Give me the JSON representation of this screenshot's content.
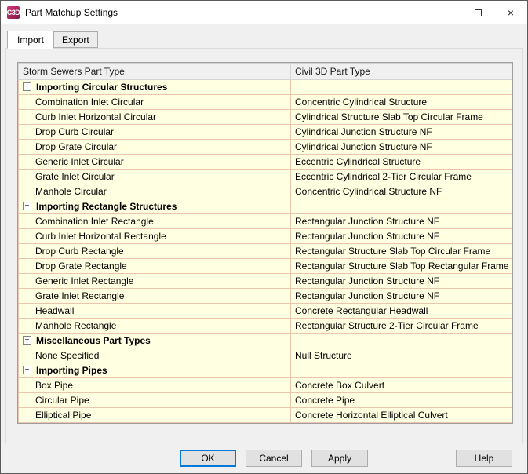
{
  "window": {
    "title": "Part Matchup Settings",
    "app_icon_text": "C3D"
  },
  "icons": {
    "collapse_glyph": "−",
    "close_glyph": "×"
  },
  "tabs": [
    {
      "label": "Import",
      "active": true
    },
    {
      "label": "Export",
      "active": false
    }
  ],
  "table": {
    "columns": [
      "Storm Sewers Part Type",
      "Civil 3D Part Type"
    ],
    "groups": [
      {
        "label": "Importing Circular Structures",
        "rows": [
          {
            "storm": "Combination Inlet Circular",
            "civil": "Concentric Cylindrical Structure"
          },
          {
            "storm": "Curb Inlet Horizontal Circular",
            "civil": "Cylindrical Structure Slab Top Circular Frame"
          },
          {
            "storm": "Drop Curb Circular",
            "civil": "Cylindrical Junction Structure NF"
          },
          {
            "storm": "Drop Grate Circular",
            "civil": "Cylindrical Junction Structure NF"
          },
          {
            "storm": "Generic Inlet Circular",
            "civil": "Eccentric Cylindrical Structure"
          },
          {
            "storm": "Grate Inlet Circular",
            "civil": "Eccentric Cylindrical 2-Tier Circular Frame"
          },
          {
            "storm": "Manhole Circular",
            "civil": "Concentric Cylindrical Structure NF"
          }
        ]
      },
      {
        "label": "Importing Rectangle Structures",
        "rows": [
          {
            "storm": "Combination Inlet Rectangle",
            "civil": "Rectangular Junction Structure NF"
          },
          {
            "storm": "Curb Inlet Horizontal Rectangle",
            "civil": "Rectangular Junction Structure NF"
          },
          {
            "storm": "Drop Curb Rectangle",
            "civil": "Rectangular Structure Slab Top Circular Frame"
          },
          {
            "storm": "Drop Grate Rectangle",
            "civil": "Rectangular Structure Slab Top Rectangular Frame"
          },
          {
            "storm": "Generic Inlet Rectangle",
            "civil": "Rectangular Junction Structure NF"
          },
          {
            "storm": "Grate Inlet Rectangle",
            "civil": "Rectangular Junction Structure NF"
          },
          {
            "storm": "Headwall",
            "civil": "Concrete Rectangular Headwall"
          },
          {
            "storm": "Manhole Rectangle",
            "civil": "Rectangular Structure 2-Tier Circular Frame"
          }
        ]
      },
      {
        "label": "Miscellaneous Part Types",
        "rows": [
          {
            "storm": "None Specified",
            "civil": "Null Structure"
          }
        ]
      },
      {
        "label": "Importing Pipes",
        "rows": [
          {
            "storm": "Box Pipe",
            "civil": "Concrete Box Culvert"
          },
          {
            "storm": "Circular Pipe",
            "civil": "Concrete Pipe"
          },
          {
            "storm": "Elliptical Pipe",
            "civil": "Concrete Horizontal Elliptical Culvert"
          }
        ]
      }
    ]
  },
  "buttons": {
    "ok": "OK",
    "cancel": "Cancel",
    "apply": "Apply",
    "help": "Help"
  },
  "colors": {
    "accent": "#0078d7",
    "row_bg": "#ffffe1",
    "grid_line": "#ecc5ad",
    "header_bg": "#f0f0f0",
    "app_icon": "#b3186d"
  }
}
